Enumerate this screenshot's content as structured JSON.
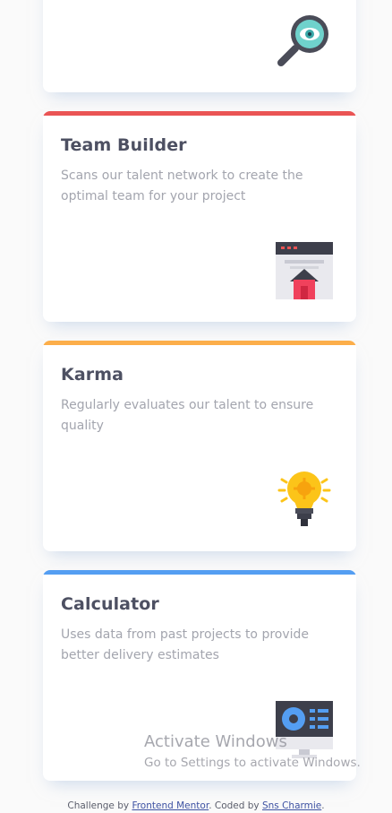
{
  "cards": [
    {
      "title": "",
      "description": "",
      "icon": "magnifier-icon",
      "accent": ""
    },
    {
      "title": "Team Builder",
      "description": "Scans our talent network to create the optimal team for your project",
      "icon": "team-builder-icon",
      "accent": "#ea5454"
    },
    {
      "title": "Karma",
      "description": "Regularly evaluates our talent to ensure quality",
      "icon": "lightbulb-icon",
      "accent": "#fcae4a"
    },
    {
      "title": "Calculator",
      "description": "Uses data from past projects to provide better delivery estimates",
      "icon": "calculator-icon",
      "accent": "#549ef2"
    }
  ],
  "footer": {
    "prefix": "Challenge by",
    "link1": "Frontend Mentor",
    "middle": ". Coded by",
    "link2": "Sns Charmie",
    "suffix": "."
  },
  "watermark": {
    "title": "Activate Windows",
    "subtitle": "Go to Settings to activate Windows."
  }
}
